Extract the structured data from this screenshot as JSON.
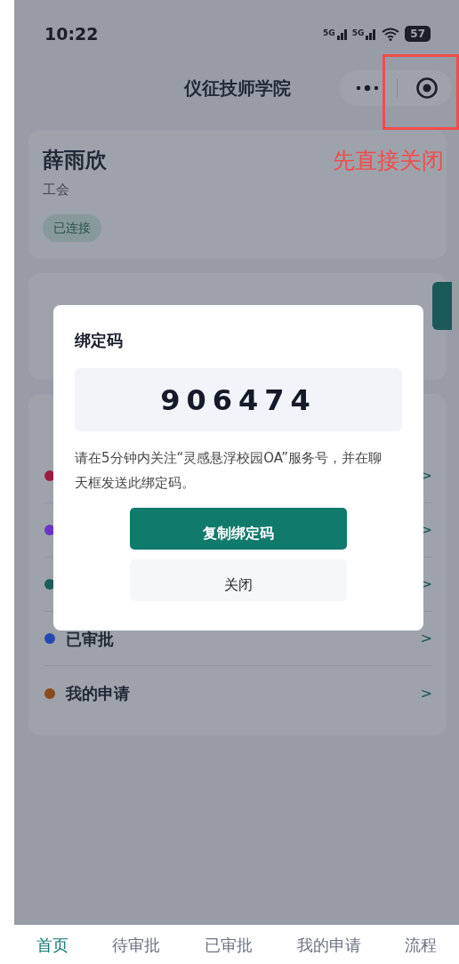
{
  "status_bar": {
    "time": "10:22",
    "signal_1": "5G",
    "signal_2": "5G",
    "battery": "57"
  },
  "nav": {
    "title": "仪征技师学院"
  },
  "profile": {
    "name": "薛雨欣",
    "department": "工会",
    "badge": "已连接"
  },
  "quick_links": [
    {
      "color": "#9b1c3d",
      "arrow": ">"
    },
    {
      "color": "#6b34c4",
      "arrow": ">"
    },
    {
      "color": "#1b5f5a",
      "arrow": ">"
    },
    {
      "color": "#2548b0",
      "label": "已审批",
      "arrow": ">"
    },
    {
      "color": "#8a4a1c",
      "label": "我的申请",
      "arrow": ">"
    }
  ],
  "dialog": {
    "title": "绑定码",
    "code": "906474",
    "message": "请在5分钟内关注“灵感悬浮校园OA”服务号，并在聊天框发送此绑定码。",
    "buttons": [
      {
        "label": "复制绑定码",
        "kind": "primary"
      },
      {
        "label": "关闭",
        "kind": "secondary"
      }
    ]
  },
  "annotation": {
    "text": "先直接关闭"
  },
  "tab_bar": [
    {
      "label": "首页",
      "selected": true
    },
    {
      "label": "待审批",
      "selected": false
    },
    {
      "label": "已审批",
      "selected": false
    },
    {
      "label": "我的申请",
      "selected": false
    },
    {
      "label": "流程",
      "selected": false
    }
  ]
}
